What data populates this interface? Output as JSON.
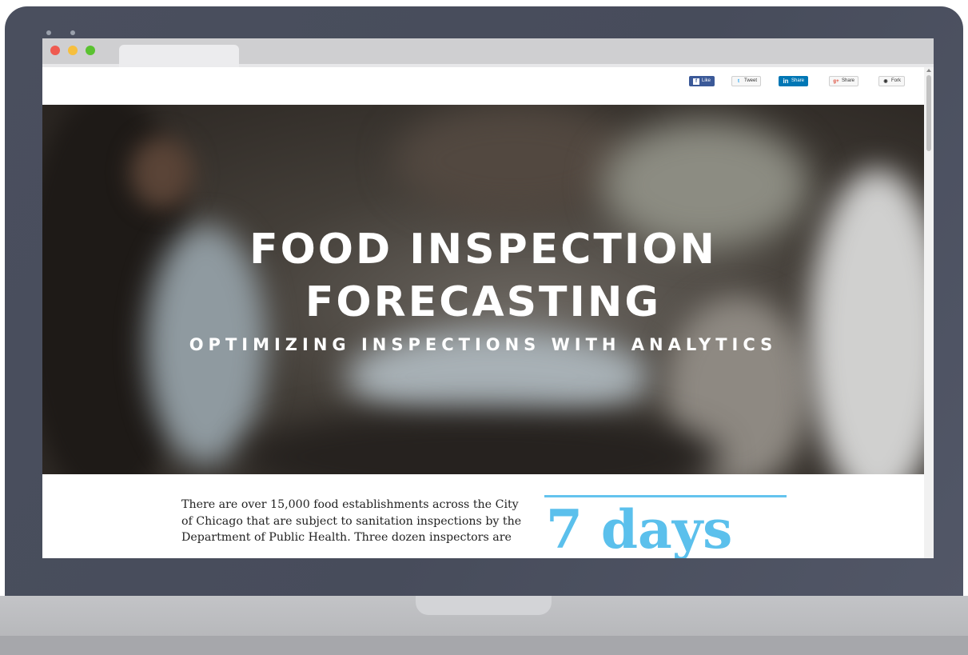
{
  "browser": {
    "share_buttons": [
      {
        "label": "Like",
        "icon": "facebook-icon"
      },
      {
        "label": "Tweet",
        "icon": "twitter-icon"
      },
      {
        "label": "Share",
        "icon": "linkedin-icon"
      },
      {
        "label": "Share",
        "icon": "google-plus-icon"
      },
      {
        "label": "Fork",
        "icon": "github-icon"
      }
    ]
  },
  "hero": {
    "title_line1": "FOOD INSPECTION",
    "title_line2": "FORECASTING",
    "subtitle": "OPTIMIZING INSPECTIONS WITH ANALYTICS"
  },
  "content": {
    "intro": "There are over 15,000 food establishments across the City\nof Chicago that are subject to sanitation inspections by the\nDepartment of Public Health. Three dozen inspectors are",
    "stat_value": "7 days"
  },
  "colors": {
    "accent": "#5bc0ec",
    "facebook": "#3b5998",
    "linkedin": "#0077b5",
    "traffic_red": "#ef5a50",
    "traffic_yellow": "#f6bf3e",
    "traffic_green": "#5ac231"
  }
}
